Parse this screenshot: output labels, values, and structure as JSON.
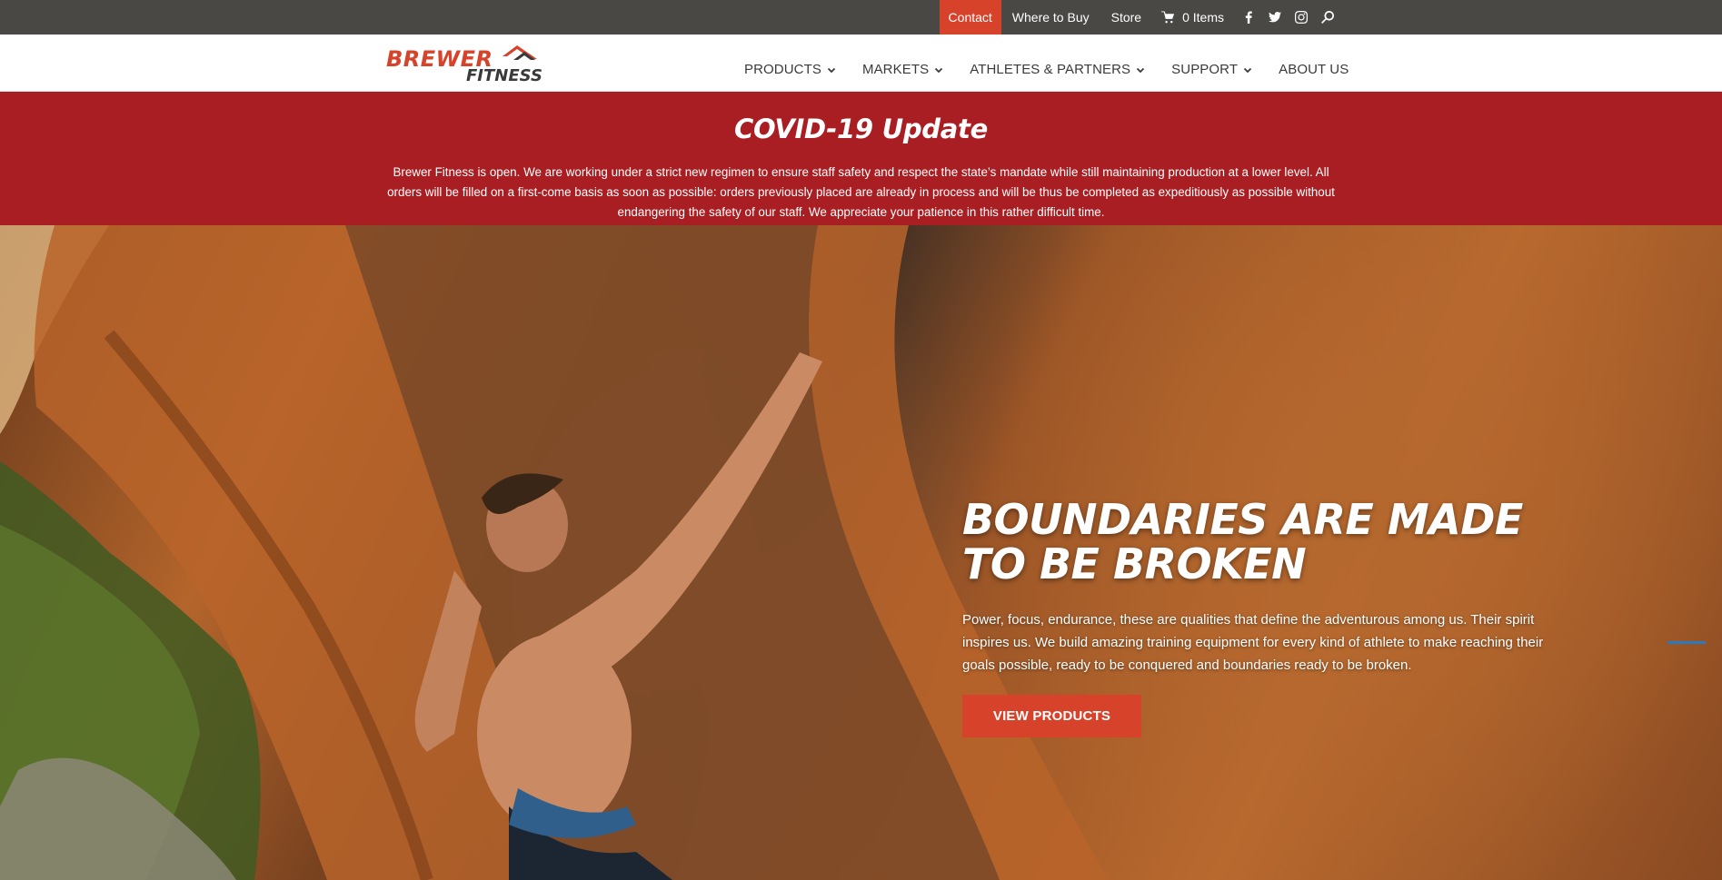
{
  "topbar": {
    "contact_label": "Contact",
    "where_to_buy_label": "Where to Buy",
    "store_label": "Store",
    "cart_label": "0 Items",
    "icons": [
      "cart-icon",
      "facebook-icon",
      "twitter-icon",
      "instagram-icon",
      "search-icon"
    ]
  },
  "header": {
    "logo_text_top": "BREWER",
    "logo_text_bottom": "FITNESS",
    "nav": [
      {
        "label": "PRODUCTS",
        "has_dropdown": true
      },
      {
        "label": "MARKETS",
        "has_dropdown": true
      },
      {
        "label": "ATHLETES & PARTNERS",
        "has_dropdown": true
      },
      {
        "label": "SUPPORT",
        "has_dropdown": true
      },
      {
        "label": "ABOUT US",
        "has_dropdown": false
      }
    ]
  },
  "covid": {
    "title": "COVID-19 Update",
    "body": "Brewer Fitness is open.  We are working under a strict new regimen to ensure staff safety and respect the state’s mandate while still maintaining production at a lower level.  All orders will be filled on a first-come basis as soon as possible: orders previously placed are already in process and will be thus be completed as expeditiously as possible without endangering the safety of our staff. We appreciate your patience in this rather difficult time."
  },
  "hero": {
    "title": "BOUNDARIES ARE MADE TO BE BROKEN",
    "text": "Power, focus, endurance, these are qualities that define the adventurous among us. Their spirit inspires us. We build amazing training equipment for every kind of athlete to make reaching their goals possible, ready to be conquered and boundaries ready to be broken.",
    "button_label": "VIEW PRODUCTS"
  },
  "colors": {
    "topbar_bg": "#4a4845",
    "accent": "#d7432a",
    "banner_red": "#a81e22",
    "nav_text": "#3a3a3a"
  }
}
